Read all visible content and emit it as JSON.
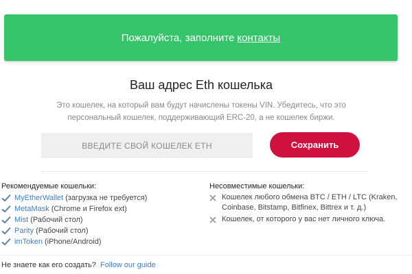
{
  "banner": {
    "text": "Пожалуйста, заполните",
    "link": "контакты",
    "bg_color": "#36c46a"
  },
  "wallet_section": {
    "title": "Ваш адрес Eth кошелька",
    "description": "Это кошелек, на который вам будут начислены токены VIN. Убедитесь, что это персональный кошелек, поддерживающий ERC-20, а не кошелек биржи.",
    "input_placeholder": "ВВЕДИТЕ СВОЙ КОШЕЛЕК ETH",
    "input_value": "",
    "save_label": "Сохранить",
    "save_color": "#d0103e"
  },
  "recommended": {
    "title": "Рекомендуемые кошельки:",
    "icon": "check-icon",
    "items": [
      {
        "name": "MyEtherWallet",
        "note": "(загрузка не требуется)"
      },
      {
        "name": "MetaMask",
        "note": "(Chrome и Firefox ext)"
      },
      {
        "name": "Mist",
        "note": "(Рабочий стол)"
      },
      {
        "name": "Parity",
        "note": "(Рабочий стол)"
      },
      {
        "name": "imToken",
        "note": "(iPhone/Android)"
      }
    ]
  },
  "incompatible": {
    "title": "Несовместимые кошельки:",
    "icon": "cross-icon",
    "items": [
      {
        "text": "Кошелек любого обмена BTC / ETH / LTC (Kraken, Coinbase, Bitstamp, Bitfinex, Bittrex и т. д.)"
      },
      {
        "text": "Кошелек, от которого у вас нет личного ключа."
      }
    ]
  },
  "footer": {
    "text": "Не знаете как его создать?",
    "link": "Follow our guide"
  },
  "colors": {
    "link": "#3b7fc4",
    "check": "#5a7fa8",
    "cross": "#9a9a9a"
  }
}
